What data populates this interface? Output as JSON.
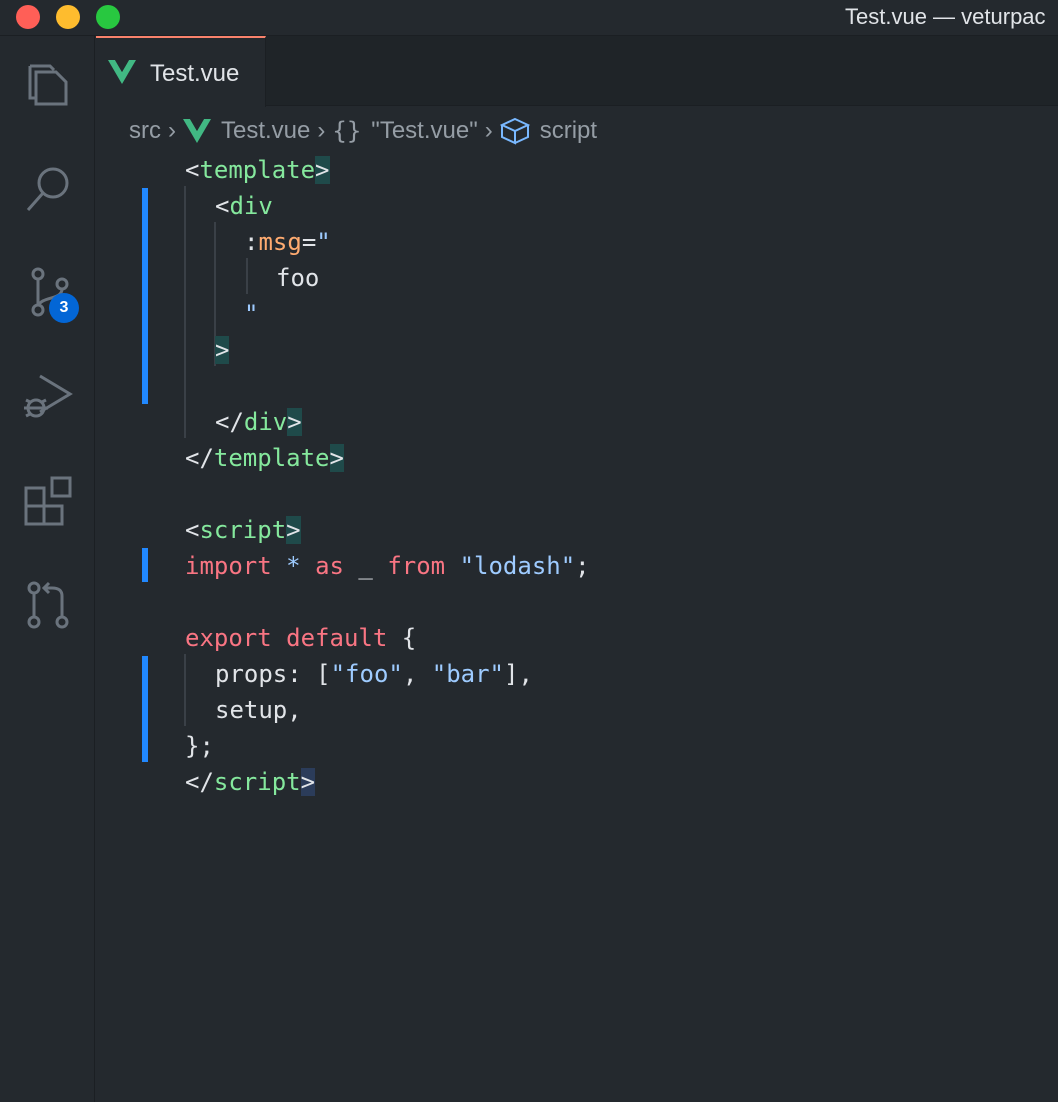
{
  "window": {
    "title": "Test.vue — veturpac",
    "traffic_colors": {
      "close": "#ff5f57",
      "minimize": "#febc2e",
      "maximize": "#28c840"
    }
  },
  "activity_bar": {
    "items": [
      {
        "name": "explorer-icon"
      },
      {
        "name": "search-icon"
      },
      {
        "name": "source-control-icon",
        "badge": "3"
      },
      {
        "name": "run-debug-icon"
      },
      {
        "name": "extensions-icon"
      },
      {
        "name": "pull-requests-icon"
      }
    ]
  },
  "tab": {
    "label": "Test.vue",
    "icon": "vue-icon",
    "accent": "#f9826c"
  },
  "breadcrumb": {
    "items": [
      {
        "label": "src"
      },
      {
        "label": "Test.vue",
        "icon": "vue-icon"
      },
      {
        "label": "\"Test.vue\"",
        "icon": "braces-icon"
      },
      {
        "label": "script",
        "icon": "cube-icon"
      }
    ]
  },
  "code": {
    "colors": {
      "tag": "#85e89d",
      "attr": "#ffab70",
      "string": "#9ecbff",
      "keyword": "#f97583",
      "text": "#e1e4e8",
      "git_modified": "#2188ff"
    },
    "lines": {
      "l1_open": "<",
      "l1_tag": "template",
      "l1_close": ">",
      "l2_open": "<",
      "l2_tag": "div",
      "l3_colon": ":",
      "l3_attr": "msg",
      "l3_eq": "=",
      "l3_quote": "\"",
      "l4_text": "foo",
      "l5_quote": "\"",
      "l6_close": ">",
      "l8_open": "</",
      "l8_tag": "div",
      "l8_close": ">",
      "l9_open": "</",
      "l9_tag": "template",
      "l9_close": ">",
      "l11_open": "<",
      "l11_tag": "script",
      "l11_close": ">",
      "l12_import": "import",
      "l12_star": "*",
      "l12_as": "as",
      "l12_underscore": "_",
      "l12_from": "from",
      "l12_str": "\"lodash\"",
      "l12_semi": ";",
      "l14_export": "export",
      "l14_default": "default",
      "l14_brace": "{",
      "l15_props": "props: [",
      "l15_foo": "\"foo\"",
      "l15_comma": ", ",
      "l15_bar": "\"bar\"",
      "l15_end": "],",
      "l16_setup": "setup,",
      "l17_end": "};",
      "l18_open": "</",
      "l18_tag": "script",
      "l18_close": ">"
    }
  }
}
